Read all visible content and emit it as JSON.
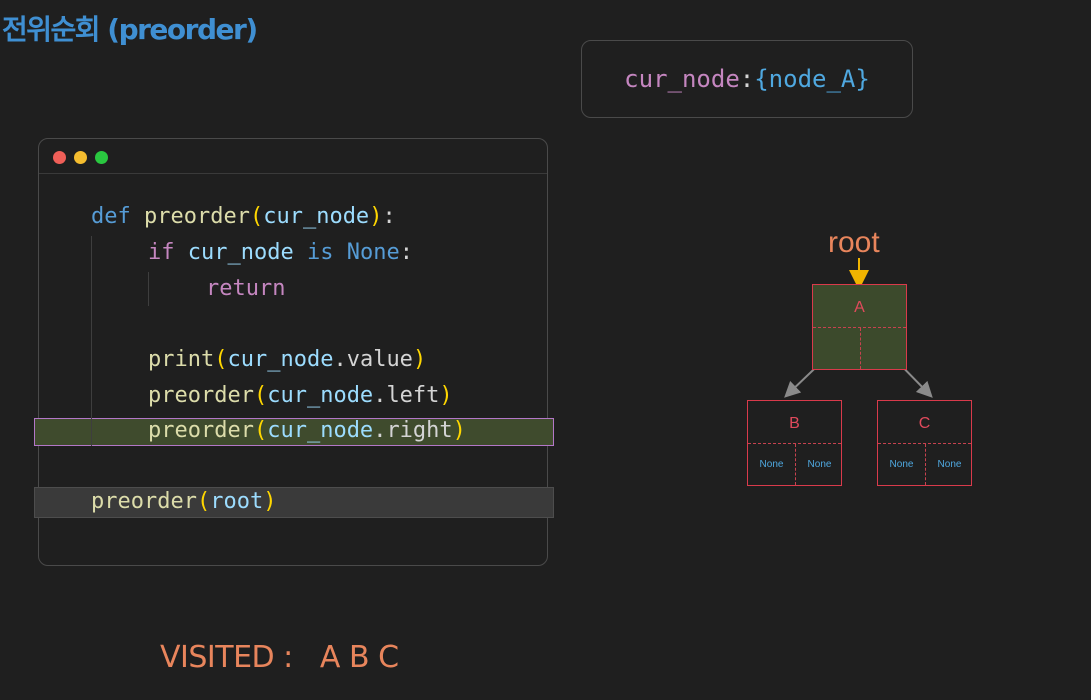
{
  "title": "전위순회 (preorder)",
  "variable": {
    "name": "cur_node",
    "colon": ":",
    "value": "{node_A}"
  },
  "code": {
    "line1": {
      "def": "def",
      "fn": "preorder",
      "open": "(",
      "arg": "cur_node",
      "close": ")",
      "colon": ":"
    },
    "line2": {
      "if": "if",
      "var": "cur_node",
      "is": "is",
      "none": "None",
      "colon": ":"
    },
    "line3": {
      "ret": "return"
    },
    "line4": {
      "fn": "print",
      "open": "(",
      "obj": "cur_node",
      "dot": ".",
      "attr": "value",
      "close": ")"
    },
    "line5": {
      "fn": "preorder",
      "open": "(",
      "obj": "cur_node",
      "dot": ".",
      "attr": "left",
      "close": ")"
    },
    "line6": {
      "fn": "preorder",
      "open": "(",
      "obj": "cur_node",
      "dot": ".",
      "attr": "right",
      "close": ")"
    },
    "line7": {
      "fn": "preorder",
      "open": "(",
      "arg": "root",
      "close": ")"
    }
  },
  "tree": {
    "root_label": "root",
    "node_a": {
      "label": "A"
    },
    "node_b": {
      "label": "B",
      "left": "None",
      "right": "None"
    },
    "node_c": {
      "label": "C",
      "left": "None",
      "right": "None"
    }
  },
  "visited": {
    "label": "VISITED :",
    "nodes": "A B C"
  },
  "colors": {
    "title": "#3f8fd2",
    "accent": "#e8855c",
    "node_border": "#d93a4b",
    "highlight": "#3f4b2d"
  }
}
